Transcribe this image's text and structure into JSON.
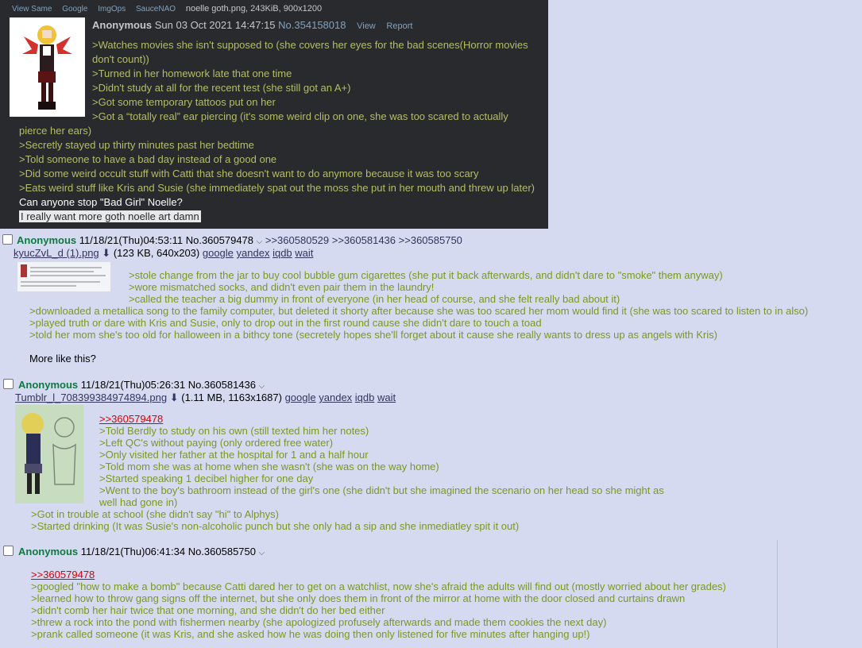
{
  "op": {
    "toolbar": [
      "View Same",
      "Google",
      "ImgOps",
      "SauceNAO"
    ],
    "file_info": "noelle goth.png, 243KiB, 900x1200",
    "name": "Anonymous",
    "datetime": "Sun 03 Oct 2021 14:47:15",
    "post_no": "No.354158018",
    "view_label": "View",
    "report_label": "Report",
    "lines": [
      ">Watches movies she isn't supposed to (she covers her eyes for the bad scenes(Horror movies",
      "don't count))",
      ">Turned in her homework late that one time",
      ">Didn't study at all for the recent test (she still got an A+)",
      ">Got some temporary tattoos put on her",
      ">Got a “totally real” ear piercing (it's some weird clip on one, she was too scared to actually",
      "pierce her ears)",
      ">Secretly stayed up thirty minutes past her bedtime",
      ">Told someone to have a bad day instead of a good one",
      ">Did some weird occult stuff with Catti that she doesn't want to do anymore because it was too scary",
      ">Eats weird stuff like Kris and Susie (she immediately spat out the moss she put in her mouth and threw up later)"
    ],
    "question": "Can anyone stop \"Bad Girl\" Noelle?",
    "highlight": "I really want more goth noelle art damn"
  },
  "posts": [
    {
      "name": "Anonymous",
      "datetime": "11/18/21(Thu)04:53:11",
      "post_no": "No.360579478",
      "replies": [
        ">>360580529",
        ">>360581436",
        ">>360585750"
      ],
      "file_name": "kyucZvL_d (1).png",
      "file_meta": "(123 KB, 640x203)",
      "file_links": [
        "google",
        "yandex",
        "iqdb",
        "wait"
      ],
      "lines": [
        ">stole change from the jar to buy cool bubble gum cigarettes (she put it back afterwards, and didn't dare to \"smoke\" them anyway)",
        ">wore mismatched socks, and didn't even pair them in the laundry!",
        ">called the teacher a big dummy in front of everyone (in her head of course, and she felt really bad about it)",
        ">downloaded a metallica song to the family computer, but deleted it shorty after because she was too scared her mom would find it (she was too scared to listen to in also)",
        ">played truth or dare with Kris and Susie, only to drop out in the first round cause she didn't dare to touch a toad",
        ">told her mom she's too old for halloween in a bithcy tone (secretely hopes she'll forget about it cause she really wants to dress up as angels with Kris)"
      ],
      "closing": "More like this?"
    },
    {
      "name": "Anonymous",
      "datetime": "11/18/21(Thu)05:26:31",
      "post_no": "No.360581436",
      "file_name": "Tumblr_l_708399384974894.png",
      "file_meta": "(1.11 MB, 1163x1687)",
      "file_links": [
        "google",
        "yandex",
        "iqdb",
        "wait"
      ],
      "quote": ">>360579478",
      "lines": [
        ">Told Berdly to study on his own (still texted him her notes)",
        ">Left QC's without paying (only ordered free water)",
        ">Only visited her father at the hospital for 1 and a half hour",
        ">Told mom she was at home when she wasn't (she was on the way home)",
        ">Started speaking 1 decibel higher for one day",
        ">Went to the boy's bathroom instead of the girl's one (she didn't but she imagined the scenario on her head so she might as",
        "well had gone in)",
        ">Got in trouble at school (she didn't say \"hi\" to Alphys)",
        ">Started drinking (It was Susie's non-alcoholic punch but she only had a sip and she inmediatley spit it out)"
      ]
    },
    {
      "name": "Anonymous",
      "datetime": "11/18/21(Thu)06:41:34",
      "post_no": "No.360585750",
      "quote": ">>360579478",
      "lines": [
        ">googled \"how to make a bomb\" because Catti dared her to get on a watchlist, now she's afraid the adults will find out (mostly worried about her grades)",
        ">learned how to throw gang signs off the internet, but she only does them in front of the mirror at home with the door closed and curtains drawn",
        ">didn't comb her hair twice that one morning, and she didn't do her bed either",
        ">threw a rock into the pond with fishermen nearby (she apologized profusely afterwards and made them cookies the next day)",
        ">prank called someone (it was Kris, and she asked how he was doing then only listened for five minutes after hanging up!)"
      ]
    }
  ],
  "colors": {
    "page_bg": "#d6daf0",
    "name": "#117743",
    "greentext": "#789922",
    "quotelink": "#dd0000",
    "dark_bg": "#282a2e",
    "dark_greentext": "#b5bd68",
    "dark_link": "#81a2be"
  },
  "icons": {
    "download": "download-icon",
    "menu": "chevron-down-icon"
  }
}
